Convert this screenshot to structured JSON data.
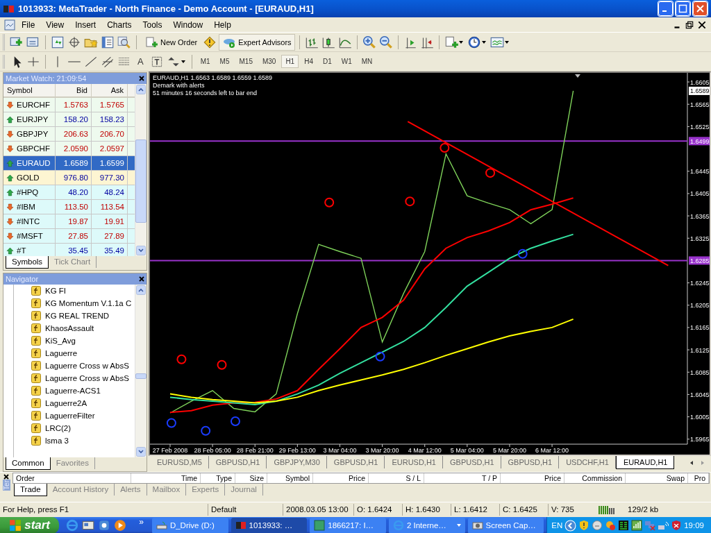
{
  "window": {
    "title": "1013933: MetaTrader - North Finance - Demo Account - [EURAUD,H1]"
  },
  "menu": [
    "File",
    "View",
    "Insert",
    "Charts",
    "Tools",
    "Window",
    "Help"
  ],
  "toolbar": {
    "new_order": "New Order",
    "expert_advisors": {
      "label": "Expert Advisors",
      "on": true
    },
    "text_tool": "A"
  },
  "timeframes": [
    {
      "label": "M1",
      "selected": false
    },
    {
      "label": "M5",
      "selected": false
    },
    {
      "label": "M15",
      "selected": false
    },
    {
      "label": "M30",
      "selected": false
    },
    {
      "label": "H1",
      "selected": true
    },
    {
      "label": "H4",
      "selected": false
    },
    {
      "label": "D1",
      "selected": false
    },
    {
      "label": "W1",
      "selected": false
    },
    {
      "label": "MN",
      "selected": false
    }
  ],
  "market_watch": {
    "title": "Market Watch: 21:09:54",
    "columns": [
      "Symbol",
      "Bid",
      "Ask"
    ],
    "rows": [
      {
        "symbol": "EURCHF",
        "bid": "1.5763",
        "ask": "1.5765",
        "up": false,
        "selected": false,
        "color": "#eefaee"
      },
      {
        "symbol": "EURJPY",
        "bid": "158.20",
        "ask": "158.23",
        "up": true,
        "selected": false,
        "color": "#eefaee"
      },
      {
        "symbol": "GBPJPY",
        "bid": "206.63",
        "ask": "206.70",
        "up": false,
        "selected": false,
        "color": "#eefaee"
      },
      {
        "symbol": "GBPCHF",
        "bid": "2.0590",
        "ask": "2.0597",
        "up": false,
        "selected": false,
        "color": "#eefaee"
      },
      {
        "symbol": "EURAUD",
        "bid": "1.6589",
        "ask": "1.6599",
        "up": true,
        "selected": true,
        "color": "#316ac5"
      },
      {
        "symbol": "GOLD",
        "bid": "976.80",
        "ask": "977.30",
        "up": true,
        "selected": false,
        "color": "#fdf5d2"
      },
      {
        "symbol": "#HPQ",
        "bid": "48.20",
        "ask": "48.24",
        "up": true,
        "selected": false,
        "color": "#ddfafa"
      },
      {
        "symbol": "#IBM",
        "bid": "113.50",
        "ask": "113.54",
        "up": false,
        "selected": false,
        "color": "#ddfafa"
      },
      {
        "symbol": "#INTC",
        "bid": "19.87",
        "ask": "19.91",
        "up": false,
        "selected": false,
        "color": "#ddfafa"
      },
      {
        "symbol": "#MSFT",
        "bid": "27.85",
        "ask": "27.89",
        "up": false,
        "selected": false,
        "color": "#ddfafa"
      },
      {
        "symbol": "#T",
        "bid": "35.45",
        "ask": "35.49",
        "up": true,
        "selected": false,
        "color": "#ddfafa"
      }
    ],
    "tabs": [
      {
        "label": "Symbols",
        "selected": true
      },
      {
        "label": "Tick Chart",
        "selected": false
      }
    ]
  },
  "navigator": {
    "title": "Navigator",
    "items": [
      "KG FI",
      "KG Momentum V.1.1a C",
      "KG REAL TREND",
      "KhaosAssault",
      "KiS_Avg",
      "Laguerre",
      "Laguerre Cross w AbsS",
      "Laguerre Cross w AbsS",
      "Laguerre-ACS1",
      "Laguerre2A",
      "LaguerreFilter",
      "LRC(2)",
      "lsma 3"
    ],
    "tabs": [
      {
        "label": "Common",
        "selected": true
      },
      {
        "label": "Favorites",
        "selected": false
      }
    ]
  },
  "chart": {
    "header": [
      "EURAUD,H1  1.6563 1.6589 1.6559 1.6589",
      "Demark with alerts",
      "51 minutes 16 seconds left to bar end"
    ],
    "chart_data": {
      "type": "line",
      "categories": [
        "27 Feb 2008",
        null,
        "28 Feb 05:00",
        null,
        "28 Feb 21:00",
        null,
        "29 Feb 13:00",
        null,
        "3 Mar 04:00",
        null,
        "3 Mar 20:00",
        null,
        "4 Mar 12:00",
        null,
        "5 Mar 04:00",
        null,
        "5 Mar 20:00",
        null,
        "6 Mar 12:00",
        null
      ],
      "series": [
        {
          "color": "#7fd35a",
          "values": [
            1.6012,
            1.6033,
            1.6052,
            1.602,
            1.6014,
            1.6046,
            1.619,
            1.6314,
            1.6301,
            1.6289,
            1.6139,
            1.6226,
            1.6301,
            1.6476,
            1.6401,
            1.6388,
            1.6376,
            1.6351,
            1.6376,
            1.6589
          ]
        },
        {
          "color": "#ff0000",
          "values": [
            1.6013,
            1.6016,
            1.6026,
            1.603,
            1.6031,
            1.6037,
            1.6052,
            1.609,
            1.6127,
            1.6165,
            1.6183,
            1.6214,
            1.627,
            1.6307,
            1.6326,
            1.6338,
            1.6353,
            1.6376,
            1.6386,
            1.6397
          ]
        },
        {
          "color": "#33e0a0",
          "values": [
            1.604,
            1.6036,
            1.6033,
            1.603,
            1.6027,
            1.6033,
            1.6046,
            1.6062,
            1.6083,
            1.6102,
            1.6121,
            1.614,
            1.6165,
            1.6201,
            1.6239,
            1.6264,
            1.6289,
            1.6307,
            1.632,
            1.6332
          ]
        },
        {
          "color": "#ffff00",
          "values": [
            1.6046,
            1.604,
            1.6036,
            1.6033,
            1.603,
            1.6033,
            1.604,
            1.6052,
            1.6062,
            1.6071,
            1.608,
            1.609,
            1.6102,
            1.6115,
            1.6127,
            1.6139,
            1.615,
            1.6158,
            1.6165,
            1.618
          ]
        }
      ],
      "ylim": [
        1.5956,
        1.662
      ],
      "yticks": [
        {
          "value": 1.5965,
          "label": "1.5965"
        },
        {
          "value": 1.6005,
          "label": "1.6005"
        },
        {
          "value": 1.6045,
          "label": "1.6045"
        },
        {
          "value": 1.6085,
          "label": "1.6085"
        },
        {
          "value": 1.6125,
          "label": "1.6125"
        },
        {
          "value": 1.6165,
          "label": "1.6165"
        },
        {
          "value": 1.6205,
          "label": "1.6205"
        },
        {
          "value": 1.6245,
          "label": "1.6245"
        },
        {
          "value": 1.6325,
          "label": "1.6325"
        },
        {
          "value": 1.6365,
          "label": "1.6365"
        },
        {
          "value": 1.6405,
          "label": "1.6405"
        },
        {
          "value": 1.6445,
          "label": "1.6445"
        },
        {
          "value": 1.6525,
          "label": "1.6525"
        },
        {
          "value": 1.6565,
          "label": "1.6565"
        },
        {
          "value": 1.6605,
          "label": "1.6605"
        }
      ],
      "ref_lines": [
        {
          "axis": "y",
          "value": 1.6499,
          "label": "1.6499",
          "color": "#9933cc"
        },
        {
          "axis": "y",
          "value": 1.6285,
          "label": "1.6285",
          "color": "#9933cc"
        }
      ]
    },
    "current_price": "1.6589"
  },
  "chart_tabs": [
    {
      "label": "EURUSD,M5",
      "selected": false
    },
    {
      "label": "GBPUSD,H1",
      "selected": false
    },
    {
      "label": "GBPJPY,M30",
      "selected": false
    },
    {
      "label": "GBPUSD,H1",
      "selected": false
    },
    {
      "label": "EURUSD,H1",
      "selected": false
    },
    {
      "label": "GBPUSD,H1",
      "selected": false
    },
    {
      "label": "GBPUSD,H1",
      "selected": false
    },
    {
      "label": "USDCHF,H1",
      "selected": false
    },
    {
      "label": "EURAUD,H1",
      "selected": true
    }
  ],
  "terminal": {
    "side_label": "Ter",
    "columns": [
      "Order",
      "Time",
      "Type",
      "Size",
      "Symbol",
      "Price",
      "S / L",
      "T / P",
      "Price",
      "Commission",
      "Swap",
      "Pro"
    ],
    "tabs": [
      {
        "label": "Trade",
        "selected": true
      },
      {
        "label": "Account History",
        "selected": false
      },
      {
        "label": "Alerts",
        "selected": false
      },
      {
        "label": "Mailbox",
        "selected": false
      },
      {
        "label": "Experts",
        "selected": false
      },
      {
        "label": "Journal",
        "selected": false
      }
    ]
  },
  "status_bar": {
    "help": "For Help, press F1",
    "profile": "Default",
    "time": "2008.03.05 13:00",
    "open": "O: 1.6424",
    "high": "H: 1.6430",
    "low": "L: 1.6412",
    "close": "C: 1.6425",
    "volume": "V: 735",
    "traffic": "129/2 kb"
  },
  "taskbar": {
    "start": "start",
    "more": "»",
    "tasks": [
      {
        "label": "D_Drive (D:)",
        "selected": false
      },
      {
        "label": "1013933: …",
        "selected": true
      },
      {
        "label": "1866217: I…",
        "selected": false
      },
      {
        "label": "2 Interne…",
        "selected": false
      },
      {
        "label": "Screen Cap…",
        "selected": false
      }
    ],
    "language": "EN",
    "clock": "19:09"
  }
}
